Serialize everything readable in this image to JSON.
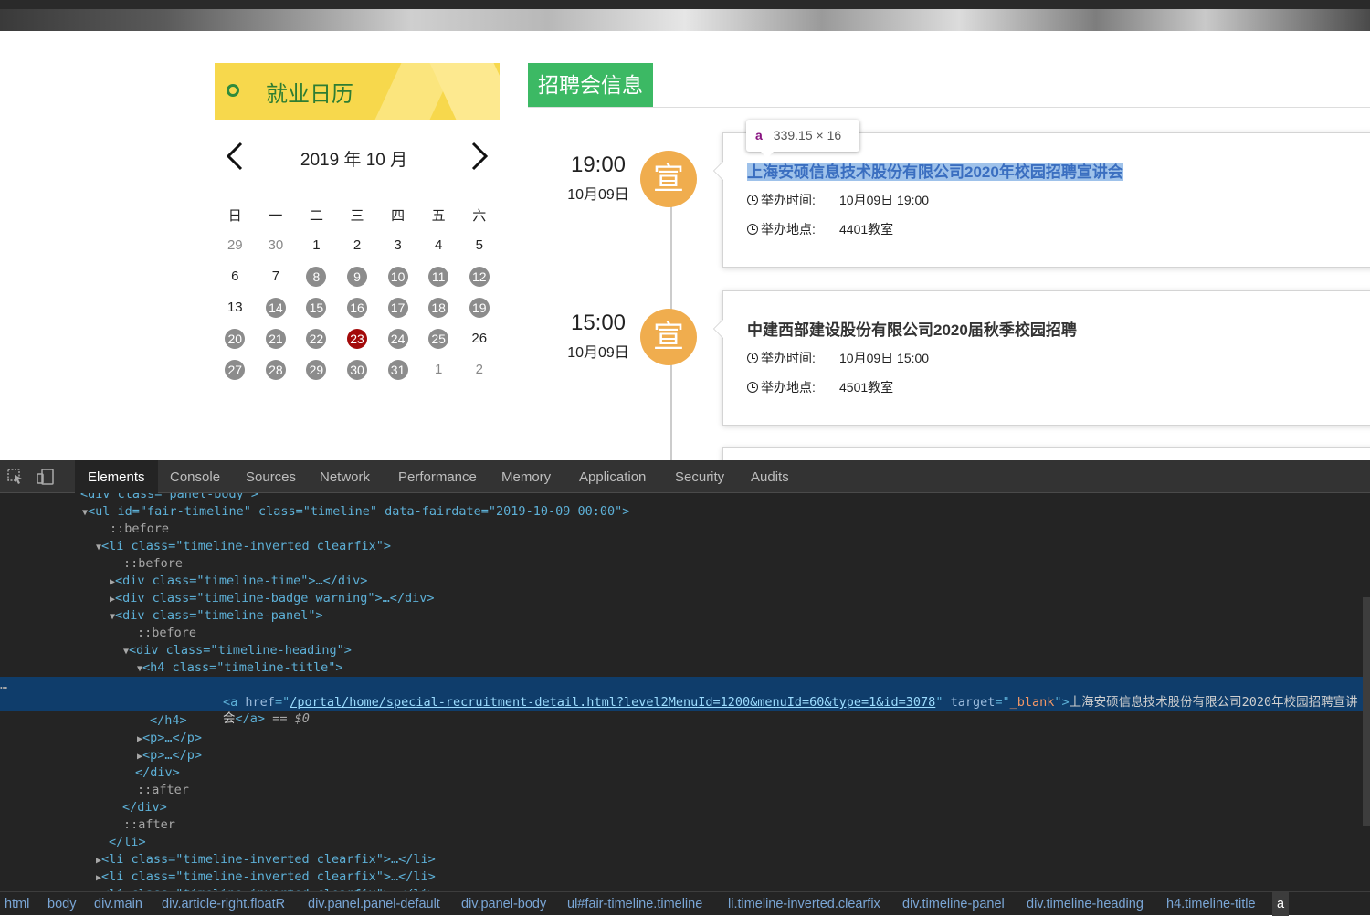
{
  "calendar": {
    "title": "就业日历",
    "month_label": "2019 年 10 月",
    "weekdays": [
      "日",
      "一",
      "二",
      "三",
      "四",
      "五",
      "六"
    ],
    "weeks": [
      [
        {
          "d": "29",
          "k": "other"
        },
        {
          "d": "30",
          "k": "other"
        },
        {
          "d": "1",
          "k": "normal"
        },
        {
          "d": "2",
          "k": "normal"
        },
        {
          "d": "3",
          "k": "normal"
        },
        {
          "d": "4",
          "k": "normal"
        },
        {
          "d": "5",
          "k": "normal"
        }
      ],
      [
        {
          "d": "6",
          "k": "normal"
        },
        {
          "d": "7",
          "k": "normal"
        },
        {
          "d": "8",
          "k": "event"
        },
        {
          "d": "9",
          "k": "event"
        },
        {
          "d": "10",
          "k": "event"
        },
        {
          "d": "11",
          "k": "event"
        },
        {
          "d": "12",
          "k": "event"
        }
      ],
      [
        {
          "d": "13",
          "k": "normal"
        },
        {
          "d": "14",
          "k": "event"
        },
        {
          "d": "15",
          "k": "event"
        },
        {
          "d": "16",
          "k": "event"
        },
        {
          "d": "17",
          "k": "event"
        },
        {
          "d": "18",
          "k": "event"
        },
        {
          "d": "19",
          "k": "event"
        }
      ],
      [
        {
          "d": "20",
          "k": "event"
        },
        {
          "d": "21",
          "k": "event"
        },
        {
          "d": "22",
          "k": "event"
        },
        {
          "d": "23",
          "k": "today"
        },
        {
          "d": "24",
          "k": "event"
        },
        {
          "d": "25",
          "k": "event"
        },
        {
          "d": "26",
          "k": "normal"
        }
      ],
      [
        {
          "d": "27",
          "k": "event"
        },
        {
          "d": "28",
          "k": "event"
        },
        {
          "d": "29",
          "k": "event"
        },
        {
          "d": "30",
          "k": "event"
        },
        {
          "d": "31",
          "k": "event"
        },
        {
          "d": "1",
          "k": "other"
        },
        {
          "d": "2",
          "k": "other"
        }
      ]
    ],
    "colors": {
      "header_bg": "#f7d84c",
      "event_day": "#8c8c8c",
      "today": "#a30a0a",
      "accent": "#2e7d32"
    }
  },
  "recruitment": {
    "tab_label": "招聘会信息",
    "badge_text": "宣",
    "time_label": "举办时间:",
    "place_label": "举办地点:",
    "events": [
      {
        "time": "19:00",
        "date": "10月09日",
        "title": "上海安硕信息技术股份有限公司2020年校园招聘宣讲会",
        "when": "10月09日 19:00",
        "where": "4401教室",
        "highlighted": true
      },
      {
        "time": "15:00",
        "date": "10月09日",
        "title": "中建西部建设股份有限公司2020届秋季校园招聘",
        "when": "10月09日 15:00",
        "where": "4501教室",
        "highlighted": false
      }
    ],
    "colors": {
      "tab": "#3cb964",
      "badge": "#f0ad4e",
      "highlight": "#9fc2ea"
    }
  },
  "tooltip": {
    "tag": "a",
    "size": "339.15 × 16"
  },
  "devtools": {
    "tabs": [
      "Elements",
      "Console",
      "Sources",
      "Network",
      "Performance",
      "Memory",
      "Application",
      "Security",
      "Audits"
    ],
    "active_tab": "Elements",
    "dom": {
      "cut_line": "<div class=\"panel-body\">",
      "ul_open": "<ul id=\"fair-timeline\" class=\"timeline\" data-fairdate=\"2019-10-09 00:00\">",
      "before": "::before",
      "after": "::after",
      "li_open": "<li class=\"timeline-inverted clearfix\">",
      "div_time": "<div class=\"timeline-time\">…</div>",
      "div_badge": "<div class=\"timeline-badge warning\">…</div>",
      "div_panel": "<div class=\"timeline-panel\">",
      "div_heading": "<div class=\"timeline-heading\">",
      "h4_open": "<h4 class=\"timeline-title\">",
      "a_href": "/portal/home/special-recruitment-detail.html?level2MenuId=1200&menuId=60&type=1&id=3078",
      "a_target": "_blank",
      "a_text_1": "上海安硕信息技术股份有限公司2020年校园招聘宣讲",
      "a_text_2": "会",
      "a_close": "</a>",
      "selected_marker": "== $0",
      "h4_close": "</h4>",
      "p_collapsed": "<p>…</p>",
      "div_close": "</div>",
      "li_close": "</li>",
      "li_collapsed": "<li class=\"timeline-inverted clearfix\">…</li>"
    },
    "breadcrumbs": [
      "html",
      "body",
      "div.main",
      "div.article-right.floatR",
      "div.panel.panel-default",
      "div.panel-body",
      "ul#fair-timeline.timeline",
      "li.timeline-inverted.clearfix",
      "div.timeline-panel",
      "div.timeline-heading",
      "h4.timeline-title",
      "a"
    ]
  }
}
